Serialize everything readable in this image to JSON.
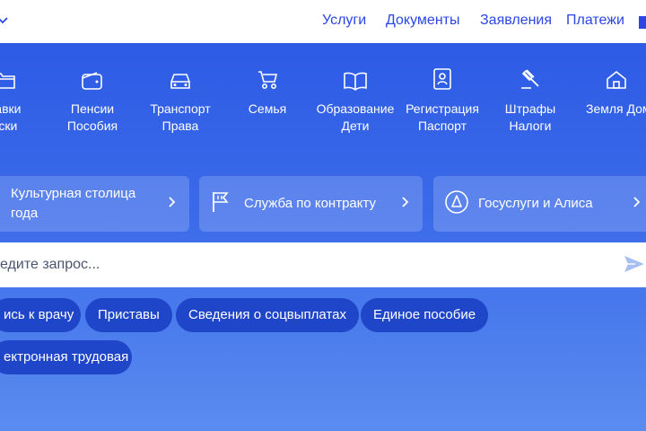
{
  "topnav": {
    "items": [
      "Услуги",
      "Документы",
      "Заявления",
      "Платежи"
    ]
  },
  "categories": [
    {
      "icon": "folder-icon",
      "line1": "равки",
      "line2": "иски"
    },
    {
      "icon": "wallet-icon",
      "line1": "Пенсии",
      "line2": "Пособия"
    },
    {
      "icon": "car-icon",
      "line1": "Транспорт",
      "line2": "Права"
    },
    {
      "icon": "stroller-icon",
      "line1": "Семья",
      "line2": ""
    },
    {
      "icon": "book-icon",
      "line1": "Образование",
      "line2": "Дети"
    },
    {
      "icon": "passport-icon",
      "line1": "Регистрация",
      "line2": "Паспорт"
    },
    {
      "icon": "gavel-icon",
      "line1": "Штрафы",
      "line2": "Налоги"
    },
    {
      "icon": "house-icon",
      "line1": "Земля Дом",
      "line2": ""
    }
  ],
  "cards": [
    {
      "text": "Культурная столица года"
    },
    {
      "icon": "flag-icon",
      "text": "Служба по контракту"
    },
    {
      "icon": "alice-icon",
      "text": "Госуслуги и Алиса"
    }
  ],
  "search": {
    "placeholder": "едите запрос..."
  },
  "chips": [
    "ись к врачу",
    "Приставы",
    "Сведения о соцвыплатах",
    "Единое пособие",
    "ектронная трудовая"
  ],
  "colors": {
    "accent": "#2a47e6",
    "hero_top": "#2d5be6",
    "hero_bottom": "#5a8cf0",
    "chip": "#1f46c9"
  }
}
